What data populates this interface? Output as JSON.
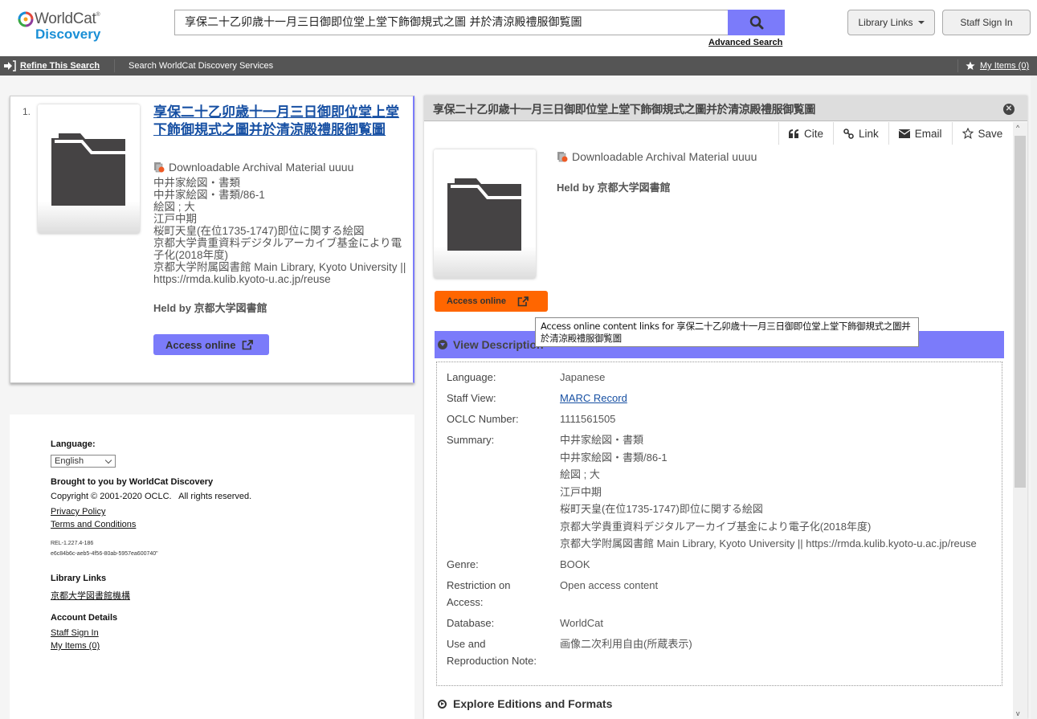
{
  "header": {
    "logo_word": "WorldCat",
    "logo_reg": "®",
    "logo_sub": "Discovery",
    "search_value": "享保二十乙卯歳十一月三日御即位堂上堂下飾御規式之圖 并於清涼殿禮服御覧圖",
    "search_icon": "search-icon",
    "advanced_search": "Advanced Search",
    "library_links": "Library Links",
    "staff_sign_in": "Staff Sign In"
  },
  "navbar": {
    "refine": "Refine This Search",
    "services": "Search WorldCat Discovery Services",
    "my_items": "My Items (0)"
  },
  "result": {
    "number": "1.",
    "title": "享保二十乙卯歳十一月三日御即位堂上堂下飾御規式之圖并於清涼殿禮服御覧圖",
    "format": "Downloadable Archival Material uuuu",
    "summary_lines": [
      "中井家絵図・書類",
      "中井家絵図・書類/86-1",
      "絵図 ; 大",
      "江戸中期",
      "桜町天皇(在位1735-1747)即位に関する絵図",
      "京都大学貴重資料デジタルアーカイブ基金により電子化(2018年度)",
      "京都大学附属図書館 Main Library, Kyoto University || https://rmda.kulib.kyoto-u.ac.jp/reuse"
    ],
    "held_by": "Held by 京都大学図書館",
    "access_online": "Access online"
  },
  "footer": {
    "language_label": "Language:",
    "language_value": "English",
    "brought": "Brought to you by WorldCat Discovery",
    "copyright": "Copyright © 2001-2020 OCLC.   All rights reserved.",
    "privacy": "Privacy Policy",
    "terms": "Terms and Conditions",
    "release": "REL-1.227.4-186",
    "build": "e6c84b6c-aeb5-4f56-80ab-5957ea600740\"",
    "library_links_heading": "Library Links",
    "library_link": "京都大学図書館機構",
    "account_heading": "Account Details",
    "staff_sign_in": "Staff Sign In",
    "my_items": "My Items (0)"
  },
  "detail": {
    "title": "享保二十乙卯歳十一月三日御即位堂上堂下飾御規式之圖并於清涼殿禮服御覧圖",
    "toolbar": [
      {
        "label": "Cite",
        "icon": "quote-icon"
      },
      {
        "label": "Link",
        "icon": "link-icon"
      },
      {
        "label": "Email",
        "icon": "envelope-icon"
      },
      {
        "label": "Save",
        "icon": "star-icon"
      }
    ],
    "format": "Downloadable Archival Material uuuu",
    "held_by": "Held by 京都大学図書館",
    "access_online": "Access online",
    "tooltip": "Access online content links for 享保二十乙卯歳十一月三日御即位堂上堂下飾御規式之圖并於清涼殿禮服御覧圖",
    "view_description": "View Description",
    "fields": {
      "language_label": "Language:",
      "language_value": "Japanese",
      "staff_view_label": "Staff View:",
      "staff_view_value": "MARC Record",
      "oclc_label": "OCLC Number:",
      "oclc_value": "1111561505",
      "summary_label": "Summary:",
      "summary_lines": [
        "中井家絵図・書類",
        "中井家絵図・書類/86-1",
        "絵図 ; 大",
        "江戸中期",
        "桜町天皇(在位1735-1747)即位に関する絵図",
        "京都大学貴重資料デジタルアーカイブ基金により電子化(2018年度)",
        "京都大学附属図書館 Main Library, Kyoto University || https://rmda.kulib.kyoto-u.ac.jp/reuse"
      ],
      "genre_label": "Genre:",
      "genre_value": "BOOK",
      "restriction_label": "Restriction on Access:",
      "restriction_value": "Open access content",
      "database_label": "Database:",
      "database_value": "WorldCat",
      "use_label": "Use and Reproduction Note:",
      "use_value": "画像二次利用自由(所蔵表示)"
    },
    "explore": "Explore Editions and Formats"
  },
  "colors": {
    "accent_purple": "#7b7bfa",
    "access_orange": "#ff6600",
    "link_blue": "#1750a3",
    "navbar_gray": "#555555"
  }
}
